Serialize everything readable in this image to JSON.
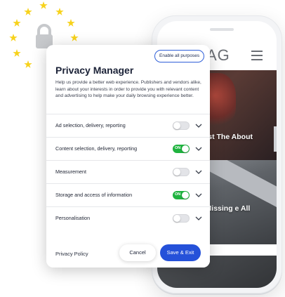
{
  "app": {
    "brand_partial": "AG",
    "headlines": [
      "der: We've Lost The About Damage",
      "Going To Be Missing e All Been Waiting"
    ]
  },
  "modal": {
    "enable_all_label": "Enable all purposes",
    "title": "Privacy Manager",
    "description": "Help us provide a better web experience. Publishers and vendors alike, learn about your interests in order to provide you with relevant content and advertising to help make your daily browsing experience better.",
    "purposes": [
      {
        "label": "Ad selection, delivery, reporting",
        "enabled": false
      },
      {
        "label": "Content selection, delivery, reporting",
        "enabled": true,
        "toggle_text": "ON"
      },
      {
        "label": "Measurement",
        "enabled": false
      },
      {
        "label": "Storage and access of information",
        "enabled": true,
        "toggle_text": "ON"
      },
      {
        "label": "Personalisation",
        "enabled": false
      }
    ],
    "footer": {
      "privacy_policy_label": "Privacy Policy",
      "cancel_label": "Cancel",
      "save_label": "Save & Exit"
    }
  },
  "colors": {
    "accent": "#2551d9",
    "toggle_on": "#1fb33f",
    "eu_star": "#f7d21b",
    "lock": "#c7c9cc"
  },
  "icons": [
    "eu-stars-icon",
    "lock-icon",
    "hamburger-menu-icon",
    "chevron-down-icon"
  ]
}
